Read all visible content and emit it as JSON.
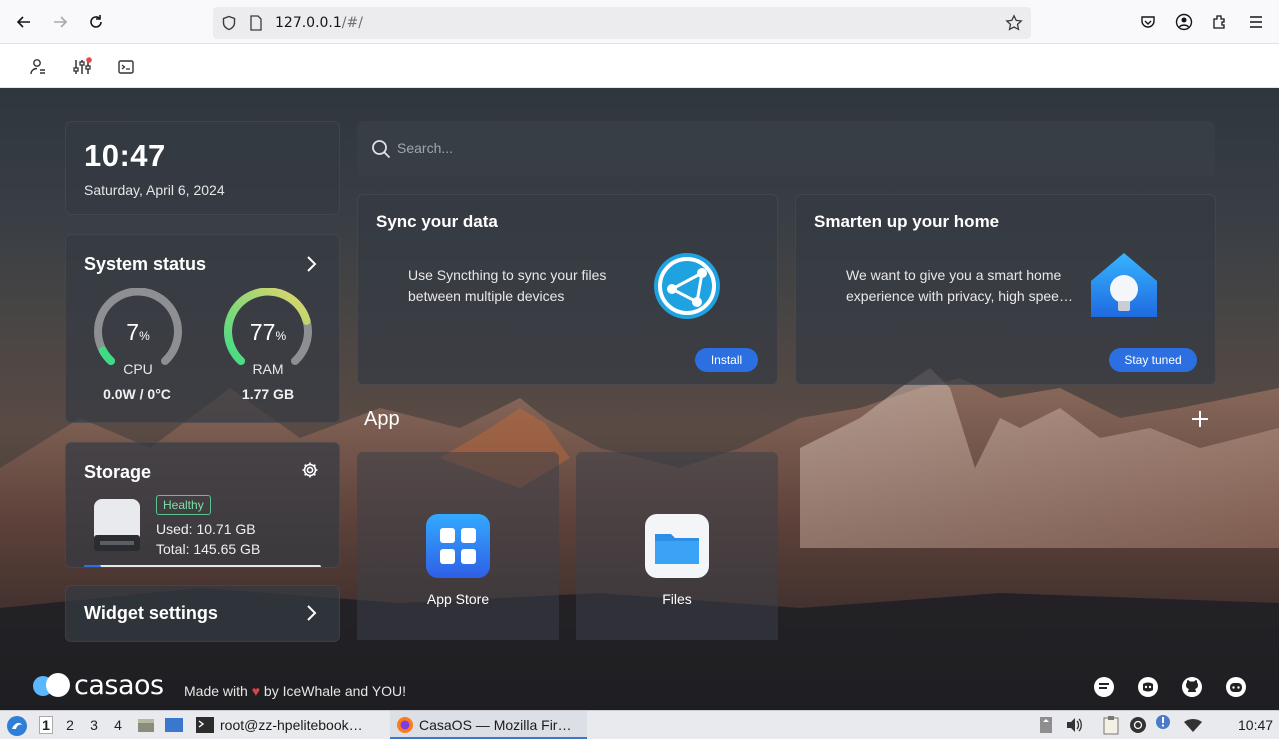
{
  "browser": {
    "url_host": "127.0.0.1",
    "url_path": "/#/"
  },
  "clock": {
    "time": "10:47",
    "date": "Saturday, April 6, 2024"
  },
  "system_status": {
    "title": "System status",
    "cpu": {
      "value": "7",
      "unit": "%",
      "label": "CPU",
      "detail": "0.0W / 0°C",
      "percent": 7
    },
    "ram": {
      "value": "77",
      "unit": "%",
      "label": "RAM",
      "detail": "1.77 GB",
      "percent": 77
    }
  },
  "storage": {
    "title": "Storage",
    "health": "Healthy",
    "used": "Used: 10.71 GB",
    "total": "Total: 145.65 GB",
    "used_fraction": 0.0735
  },
  "widget_settings": {
    "label": "Widget settings"
  },
  "search": {
    "placeholder": "Search..."
  },
  "promos": [
    {
      "title": "Sync your data",
      "desc": "Use Syncthing to sync your files between multiple devices",
      "button": "Install"
    },
    {
      "title": "Smarten up your home",
      "desc": "We want to give you a smart home experience with privacy, high spee…",
      "button": "Stay tuned"
    }
  ],
  "apps": {
    "header": "App",
    "items": [
      {
        "label": "App Store"
      },
      {
        "label": "Files"
      }
    ]
  },
  "footer": {
    "brand": "casaos",
    "made_with": "Made with",
    "by_text": "by IceWhale and YOU!"
  },
  "taskbar": {
    "workspaces": [
      "1",
      "2",
      "3",
      "4"
    ],
    "terminal_task": "root@zz-hpelitebook…",
    "firefox_task": "CasaOS — Mozilla Fir…",
    "time": "10:47"
  },
  "colors": {
    "accent_blue": "#2b6fe0",
    "healthy_green": "#58c58a",
    "gauge_green": "#3ddc84",
    "gauge_yellow": "#e8d46a"
  }
}
